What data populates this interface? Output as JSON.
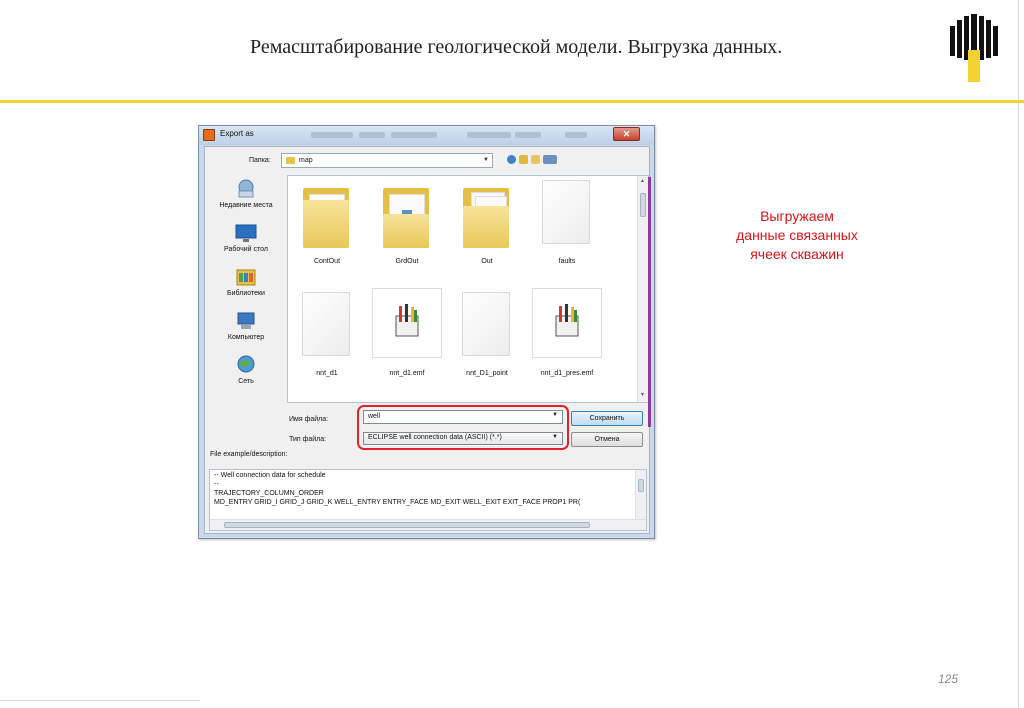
{
  "slide": {
    "title": "Ремасштабирование геологической модели. Выгрузка данных.",
    "callout_lines": [
      "Выгружаем",
      "данные связанных",
      "ячеек скважин"
    ],
    "page_number": "125",
    "accent_color": "#f2d130",
    "callout_color": "#d8151b"
  },
  "dialog": {
    "title": "Export as",
    "close_glyph": "✕",
    "look_in_label": "Папка:",
    "look_in_value": "map",
    "places": [
      {
        "label": "Недавние места",
        "icon": "recent-places-icon"
      },
      {
        "label": "Рабочий стол",
        "icon": "desktop-icon"
      },
      {
        "label": "Библиотеки",
        "icon": "libraries-icon"
      },
      {
        "label": "Компьютер",
        "icon": "computer-icon"
      },
      {
        "label": "Сеть",
        "icon": "network-icon"
      }
    ],
    "files": [
      {
        "name": "ContOut",
        "type": "folder"
      },
      {
        "name": "GrdOut",
        "type": "folder"
      },
      {
        "name": "Out",
        "type": "folder"
      },
      {
        "name": "faults",
        "type": "file"
      },
      {
        "name": "nnt_d1",
        "type": "file"
      },
      {
        "name": "nnt_d1.emf",
        "type": "emf"
      },
      {
        "name": "nnt_D1_point",
        "type": "file"
      },
      {
        "name": "nnt_d1_pres.emf",
        "type": "emf"
      }
    ],
    "file_name_label": "Имя файла:",
    "file_name_value": "well",
    "file_type_label": "Тип файла:",
    "file_type_value": "ECLIPSE well connection data (ASCII) (*.*)",
    "save_label": "Сохранить",
    "cancel_label": "Отмена",
    "example_label": "File example/description:",
    "example_lines": [
      "-- Well connection data for schedule",
      "--",
      "TRAJECTORY_COLUMN_ORDER",
      "MD_ENTRY GRID_I GRID_J GRID_K WELL_ENTRY ENTRY_FACE MD_EXIT WELL_EXIT EXIT_FACE PROP1 PR("
    ]
  }
}
